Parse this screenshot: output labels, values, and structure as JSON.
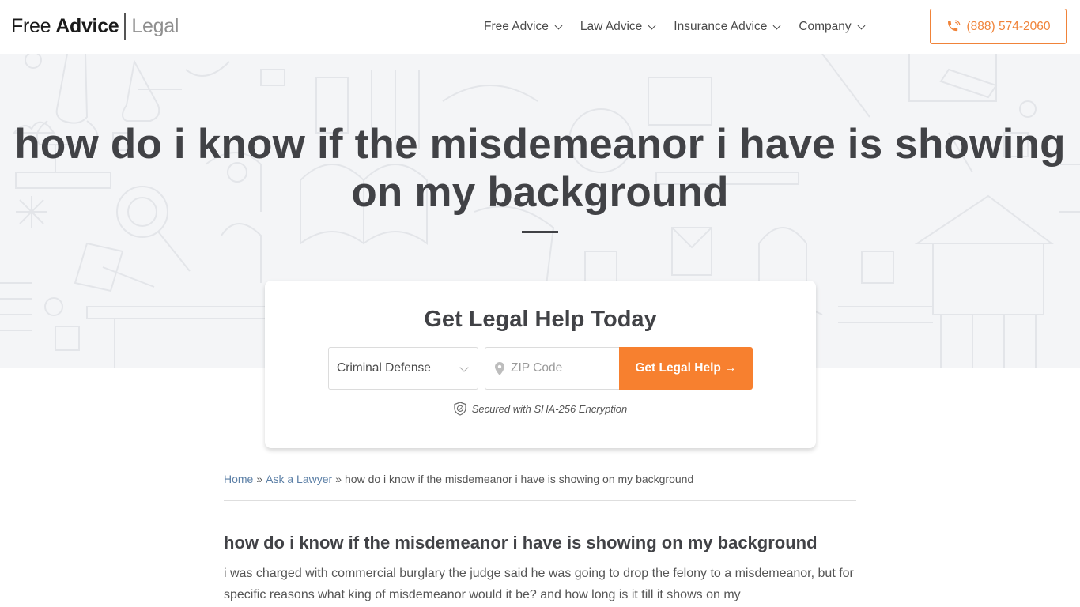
{
  "header": {
    "logo": {
      "part1": "Free",
      "part2": "Advice",
      "part3": "Legal"
    },
    "nav": [
      {
        "label": "Free Advice"
      },
      {
        "label": "Law Advice"
      },
      {
        "label": "Insurance Advice"
      },
      {
        "label": "Company"
      }
    ],
    "phone": "(888) 574-2060",
    "phone_icon": "phone-ringing-icon"
  },
  "hero": {
    "title": "how do i know if the misdemeanor i have is showing on my background"
  },
  "lead_form": {
    "title": "Get Legal Help Today",
    "category_selected": "Criminal Defense",
    "zip_placeholder": "ZIP Code",
    "zip_value": "",
    "submit_label": "Get Legal Help →",
    "secure_text": "Secured with SHA-256 Encryption",
    "colors": {
      "accent": "#f7802f"
    }
  },
  "breadcrumb": {
    "items": [
      {
        "label": "Home"
      },
      {
        "label": "Ask a Lawyer"
      },
      {
        "label": "how do i know if the misdemeanor i have is showing on my background"
      }
    ],
    "separator": "»"
  },
  "question": {
    "title": "how do i know if the misdemeanor i have is showing on my background",
    "body": "i was charged with commercial burglary the judge said he was going to drop the felony to a misdemeanor, but for specific reasons what king of misdemeanor would it be? and how long is it till it shows on my"
  }
}
